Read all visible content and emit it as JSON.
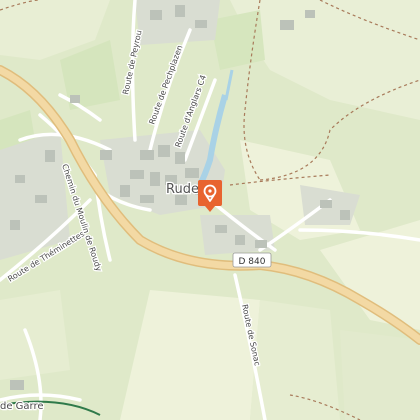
{
  "map": {
    "town_label": "Rudelle",
    "highway_shield": "D 840",
    "road_labels": {
      "peyrou": "Route de Peyrou",
      "pechplazen": "Route de Pechplazen",
      "anglars": "Route d'Anglars C4",
      "theminettes": "Route de Théminettes",
      "moulin_roudy": "Chemin du Moulin de Roudy",
      "sonac": "Route de Sonac",
      "garre": "de Garre"
    },
    "marker_icon": "location-pin-icon",
    "colors": {
      "meadow": "#dfe9c9",
      "field_light": "#eef2da",
      "field_green": "#cfe3b3",
      "road_main": "#f3d9a4",
      "road_casing": "#e0bd7c",
      "road_minor": "#ffffff",
      "building": "#bcc2b9",
      "residential": "#d9ddd2",
      "water": "#a9d2e6",
      "path": "#a87a5a",
      "marker": "#e8642f"
    }
  }
}
